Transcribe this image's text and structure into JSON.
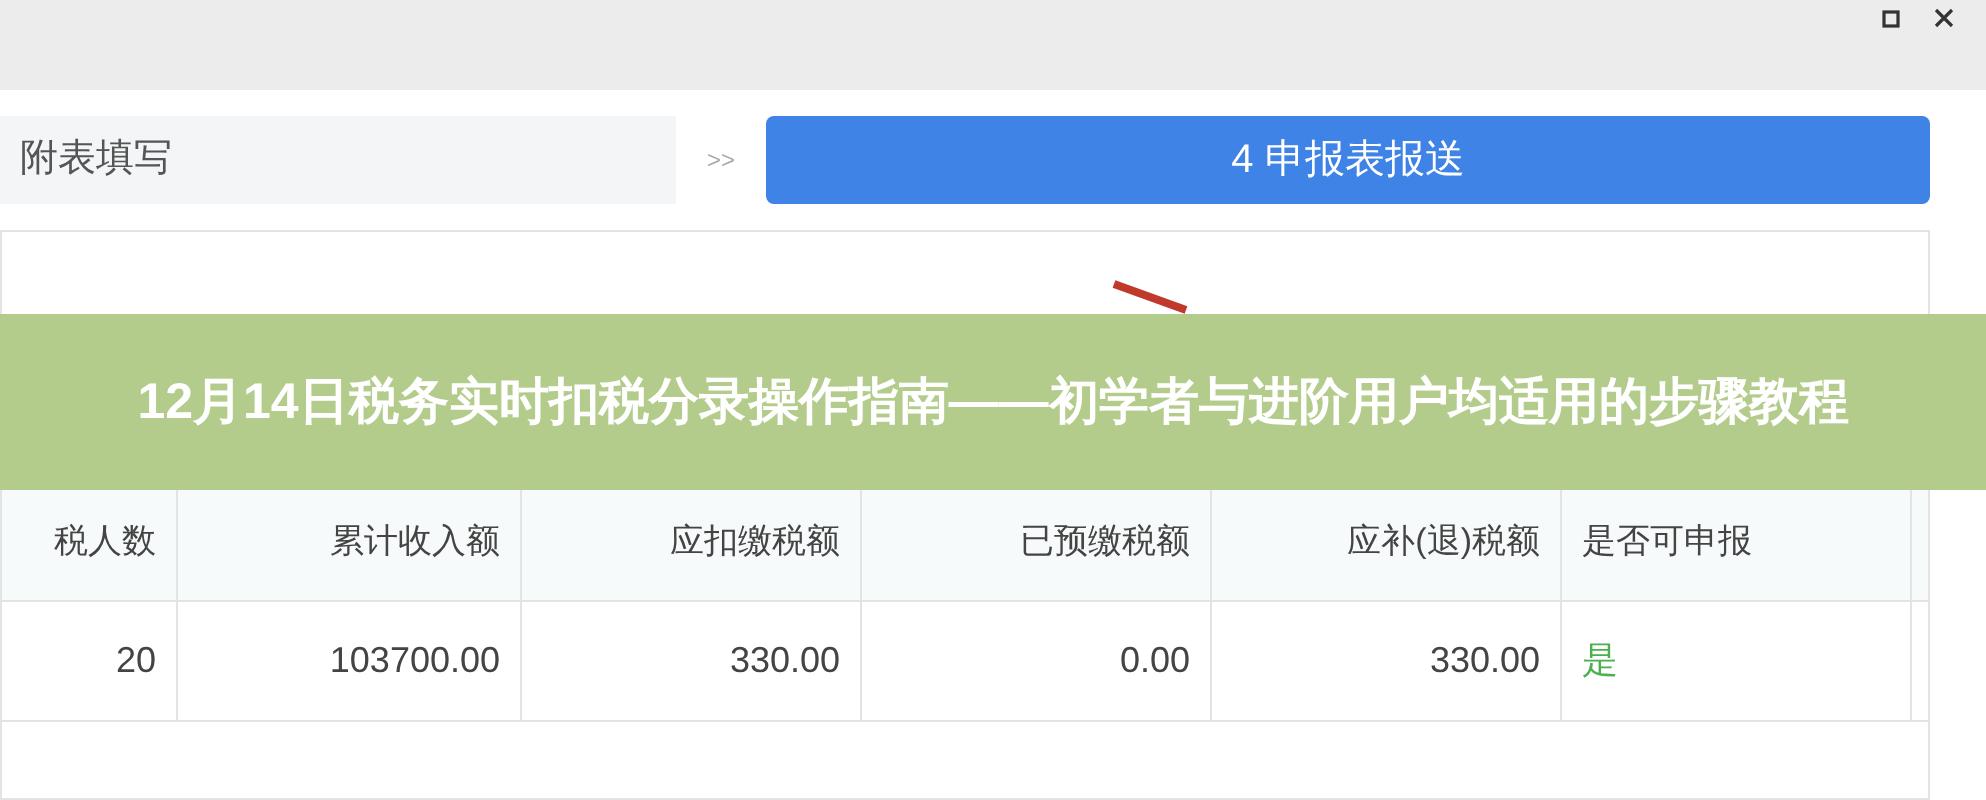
{
  "steps": [
    {
      "label": "附表填写",
      "selected": false
    },
    {
      "label": "4 申报表报送",
      "selected": true
    }
  ],
  "step_separator": ">>",
  "banner": {
    "title": "12月14日税务实时扣税分录操作指南——初学者与进阶用户均适用的步骤教程"
  },
  "table": {
    "columns": [
      "税人数",
      "累计收入额",
      "应扣缴税额",
      "已预缴税额",
      "应补(退)税额",
      "是否可申报"
    ],
    "rows": [
      [
        "20",
        "103700.00",
        "330.00",
        "0.00",
        "330.00",
        "是"
      ]
    ]
  }
}
